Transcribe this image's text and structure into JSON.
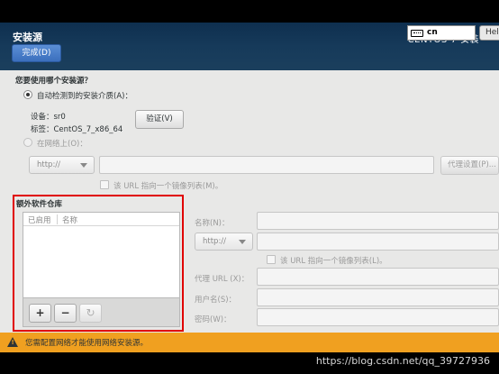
{
  "header": {
    "title": "安装源",
    "done_label": "完成(D)",
    "product": "CENTOS 7 安装",
    "keyboard_layout": "cn",
    "help_label": "Hel"
  },
  "source": {
    "question": "您要使用哪个安装源？",
    "auto_detect_label": "自动检测到的安装介质(A)：",
    "device_label": "设备：sr0",
    "tag_label": "标签：CentOS_7_x86_64",
    "verify_label": "验证(V)",
    "network_label": "在网络上(O)：",
    "protocol": "http://",
    "proxy_label": "代理设置(P)...",
    "mirrorlist_label": "该 URL 指向一个镜像列表(M)。"
  },
  "repos": {
    "heading": "额外软件仓库",
    "col_enabled": "已启用",
    "col_name": "名称",
    "add_label": "+",
    "remove_label": "−",
    "reset_label": "↻"
  },
  "repo_detail": {
    "name_label": "名称(N)：",
    "protocol": "http://",
    "mirrorlist_label": "该 URL 指向一个镜像列表(L)。",
    "proxy_url_label": "代理 URL (X)：",
    "username_label": "用户名(S)：",
    "password_label": "密码(W)："
  },
  "status": {
    "message": "您需配置网络才能使用网络安装源。"
  },
  "watermark": "https://blog.csdn.net/qq_39727936",
  "colors": {
    "header_bg": "#163a5a",
    "done_button": "#4a7fcc",
    "warning_bar": "#f0a020",
    "highlight_border": "#e00000"
  }
}
